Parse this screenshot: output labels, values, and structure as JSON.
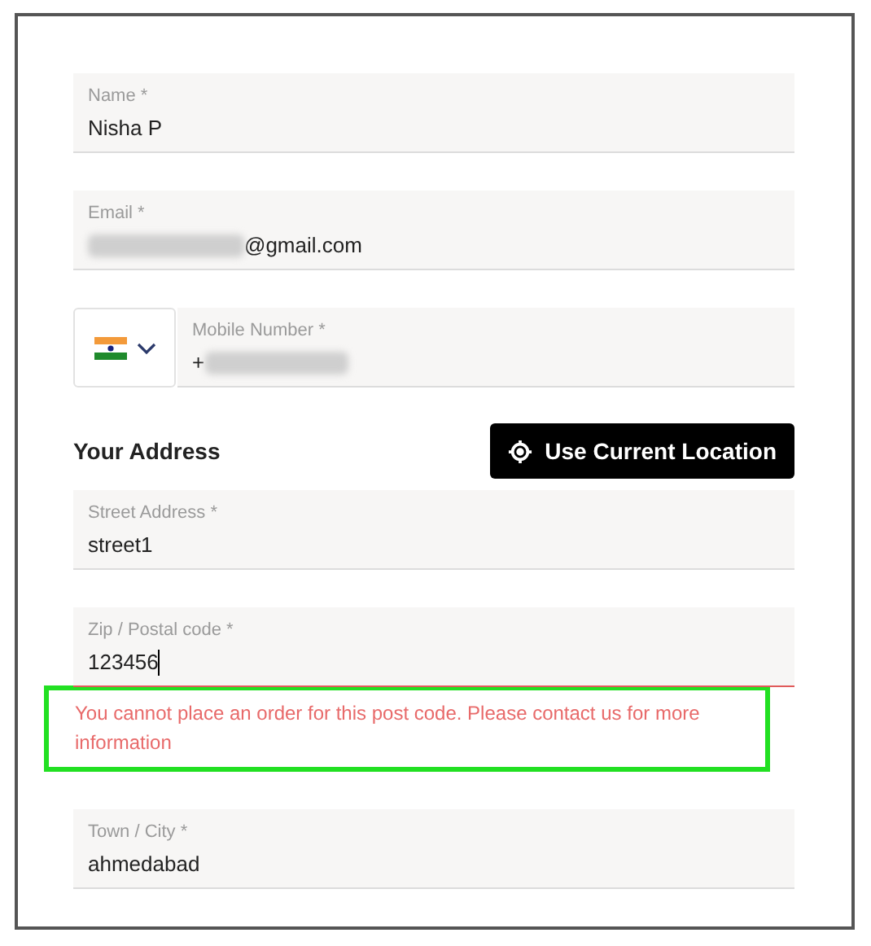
{
  "contact_fields": [
    {
      "kind": "text",
      "label": "Name *",
      "value": "Nisha P",
      "blurred_prefix": false,
      "blurred_suffix": false,
      "error": false
    },
    {
      "kind": "text",
      "label": "Email *",
      "value": "@gmail.com",
      "blurred_prefix": true,
      "blurred_suffix": false,
      "error": false
    },
    {
      "kind": "phone",
      "label": "Mobile Number *",
      "value": "+",
      "blurred_prefix": false,
      "blurred_suffix": true,
      "error": false
    }
  ],
  "address": {
    "heading": "Your Address",
    "location_button": "Use Current Location",
    "fields": [
      {
        "label": "Street Address *",
        "value": "street1",
        "error": false,
        "focused": false
      },
      {
        "label": "Zip / Postal code *",
        "value": "123456",
        "error": true,
        "focused": true,
        "error_message": "You cannot place an order for this post code. Please contact us for more information",
        "highlighted": true
      },
      {
        "label": "Town / City *",
        "value": "ahmedabad",
        "error": false,
        "focused": false
      }
    ]
  }
}
